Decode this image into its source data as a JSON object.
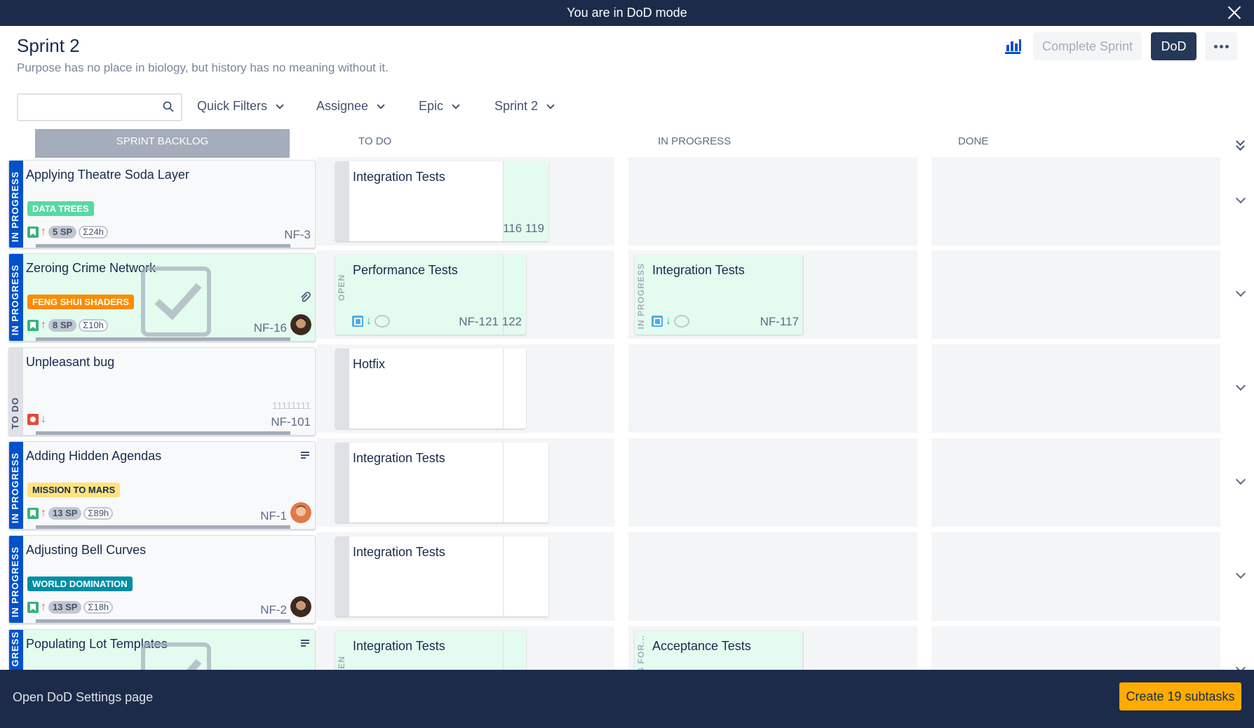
{
  "banner": {
    "text": "You are in DoD mode"
  },
  "header": {
    "title": "Sprint 2",
    "subtitle": "Purpose has no place in biology, but history has no meaning without it.",
    "complete_label": "Complete Sprint",
    "dod_label": "DoD"
  },
  "filters": {
    "search_placeholder": "",
    "items": [
      "Quick Filters",
      "Assignee",
      "Epic",
      "Sprint 2"
    ]
  },
  "columns": [
    "SPRINT BACKLOG",
    "TO DO",
    "IN PROGRESS",
    "DONE"
  ],
  "colors": {
    "accent": "#0052cc",
    "banner": "#1c2b4a",
    "done_green": "#e3fcef",
    "create": "#ffab00"
  },
  "rows": [
    {
      "status": "IN PROGRESS",
      "summary": "Applying Theatre Soda Layer",
      "epic": "DATA TREES",
      "epic_color": "#57d9a3",
      "points": "5 SP",
      "time": "Σ24h",
      "key": "NF-3",
      "todo": {
        "title": "Integration Tests",
        "strip": "",
        "key": "116 119"
      },
      "inprogress": null
    },
    {
      "status": "IN PROGRESS",
      "summary": "Zeroing Crime Network",
      "epic": "FENG SHUI SHADERS",
      "epic_color": "#ff8b00",
      "points": "8 SP",
      "time": "Σ10h",
      "key": "NF-16",
      "todo": {
        "title": "Performance Tests",
        "strip": "OPEN",
        "key": "NF-121 122"
      },
      "inprogress": {
        "title": "Integration Tests",
        "strip": "IN PROGRESS",
        "key": "NF-117"
      }
    },
    {
      "status": "TO DO",
      "summary": "Unpleasant bug",
      "version": "11111111",
      "key": "NF-101",
      "todo": {
        "title": "Hotfix",
        "strip": "",
        "key": ""
      },
      "inprogress": null
    },
    {
      "status": "IN PROGRESS",
      "summary": "Adding Hidden Agendas",
      "epic": "MISSION TO MARS",
      "epic_color": "#ffe380",
      "points": "13 SP",
      "time": "Σ89h",
      "key": "NF-1",
      "todo": {
        "title": "Integration Tests",
        "strip": "",
        "key": ""
      },
      "inprogress": null
    },
    {
      "status": "IN PROGRESS",
      "summary": "Adjusting Bell Curves",
      "epic": "WORLD DOMINATION",
      "epic_color": "#008da6",
      "points": "13 SP",
      "time": "Σ18h",
      "key": "NF-2",
      "todo": {
        "title": "Integration Tests",
        "strip": "",
        "key": ""
      },
      "inprogress": null
    },
    {
      "status": "GRESS",
      "summary": "Populating Lot Templates",
      "todo": {
        "title": "Integration Tests",
        "strip": "EN",
        "key": ""
      },
      "inprogress": {
        "title": "Acceptance Tests",
        "strip": "G FOR...",
        "key": ""
      }
    }
  ],
  "footer": {
    "settings_link": "Open DoD Settings page",
    "create_label": "Create 19 subtasks"
  }
}
